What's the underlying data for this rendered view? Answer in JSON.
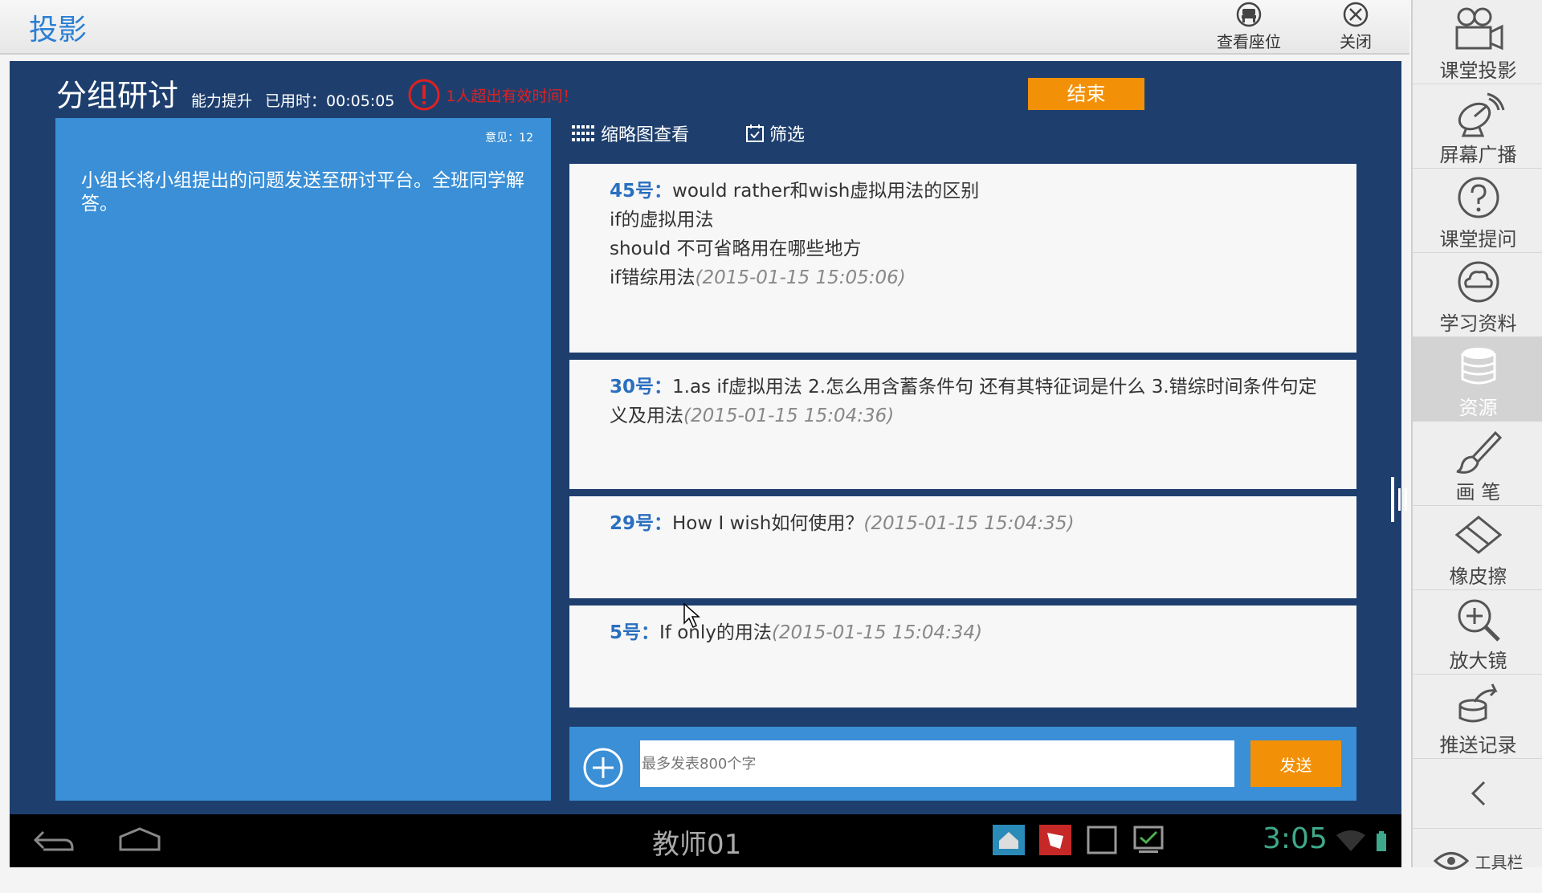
{
  "app": {
    "title": "投影"
  },
  "top_actions": {
    "view_seats": "查看座位",
    "close": "关闭"
  },
  "sidebar": {
    "items": [
      {
        "label": "课堂投影",
        "icon": "video-camera-icon"
      },
      {
        "label": "屏幕广播",
        "icon": "satellite-dish-icon"
      },
      {
        "label": "课堂提问",
        "icon": "question-icon"
      },
      {
        "label": "学习资料",
        "icon": "cloud-icon"
      },
      {
        "label": "资源",
        "icon": "database-icon"
      },
      {
        "label": "画  笔",
        "icon": "brush-icon"
      },
      {
        "label": "橡皮擦",
        "icon": "eraser-icon"
      },
      {
        "label": "放大镜",
        "icon": "magnifier-icon"
      },
      {
        "label": "推送记录",
        "icon": "push-record-icon"
      }
    ],
    "toolbar_label": "工具栏"
  },
  "session": {
    "title": "分组研讨",
    "subtitle": "能力提升",
    "elapsed_label": "已用时：",
    "elapsed": "00:05:05",
    "warning": "1人超出有效时间！",
    "end_button": "结束"
  },
  "left_panel": {
    "count": "意见：12",
    "description": "小组长将小组提出的问题发送至研讨平台。全班同学解答。"
  },
  "view_tabs": {
    "thumbnail": "缩略图查看",
    "filter": "筛选"
  },
  "messages": [
    {
      "no": "45号：",
      "lines": [
        "would rather和wish虚拟用法的区别",
        "if的虚拟用法",
        "should 不可省略用在哪些地方",
        "if错综用法"
      ],
      "time": "(2015-01-15 15:05:06)"
    },
    {
      "no": "30号：",
      "lines": [
        "1.as  if虚拟用法    2.怎么用含蓄条件句   还有其特征词是什么    3.错综时间条件句定义及用法"
      ],
      "time": "(2015-01-15 15:04:36)"
    },
    {
      "no": "29号：",
      "lines": [
        "How I wish如何使用？"
      ],
      "time": "(2015-01-15 15:04:35)"
    },
    {
      "no": "5号：",
      "lines": [
        "If only的用法"
      ],
      "time": "(2015-01-15 15:04:34)"
    }
  ],
  "compose": {
    "placeholder": "最多发表800个字",
    "send_label": "发送"
  },
  "navbar": {
    "user": "教师01",
    "clock": "3:05"
  }
}
